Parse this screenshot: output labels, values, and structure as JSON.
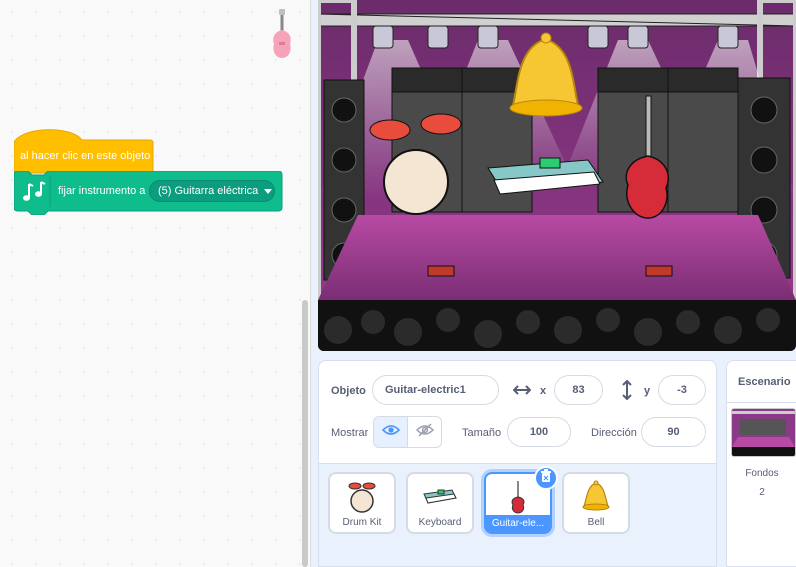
{
  "code": {
    "hat_block": {
      "label": "al hacer clic en este objeto",
      "color": "#ffbf00"
    },
    "music_block": {
      "label": "fijar instrumento a",
      "instrument": "(5) Guitarra eléctrica",
      "color": "#0fbd8c",
      "icon": "music-notes-icon"
    }
  },
  "sprite_info": {
    "object_label": "Objeto",
    "sprite_name": "Guitar-electric1",
    "x_label": "x",
    "x_value": "83",
    "y_label": "y",
    "y_value": "-3",
    "show_label": "Mostrar",
    "size_label": "Tamaño",
    "size_value": "100",
    "direction_label": "Dirección",
    "direction_value": "90"
  },
  "sprites": [
    {
      "name": "Drum Kit",
      "icon": "drum-kit-icon",
      "selected": false
    },
    {
      "name": "Keyboard",
      "icon": "keyboard-icon",
      "selected": false
    },
    {
      "name": "Guitar-ele...",
      "icon": "electric-guitar-icon",
      "selected": true
    },
    {
      "name": "Bell",
      "icon": "bell-icon",
      "selected": false
    }
  ],
  "stage_selector": {
    "title": "Escenario",
    "backdrops_label": "Fondos",
    "backdrops_count": "2"
  },
  "colors": {
    "accent": "#4c97ff",
    "stage_floor": "#a23d8f",
    "stage_bg": "#5a2b5a"
  }
}
